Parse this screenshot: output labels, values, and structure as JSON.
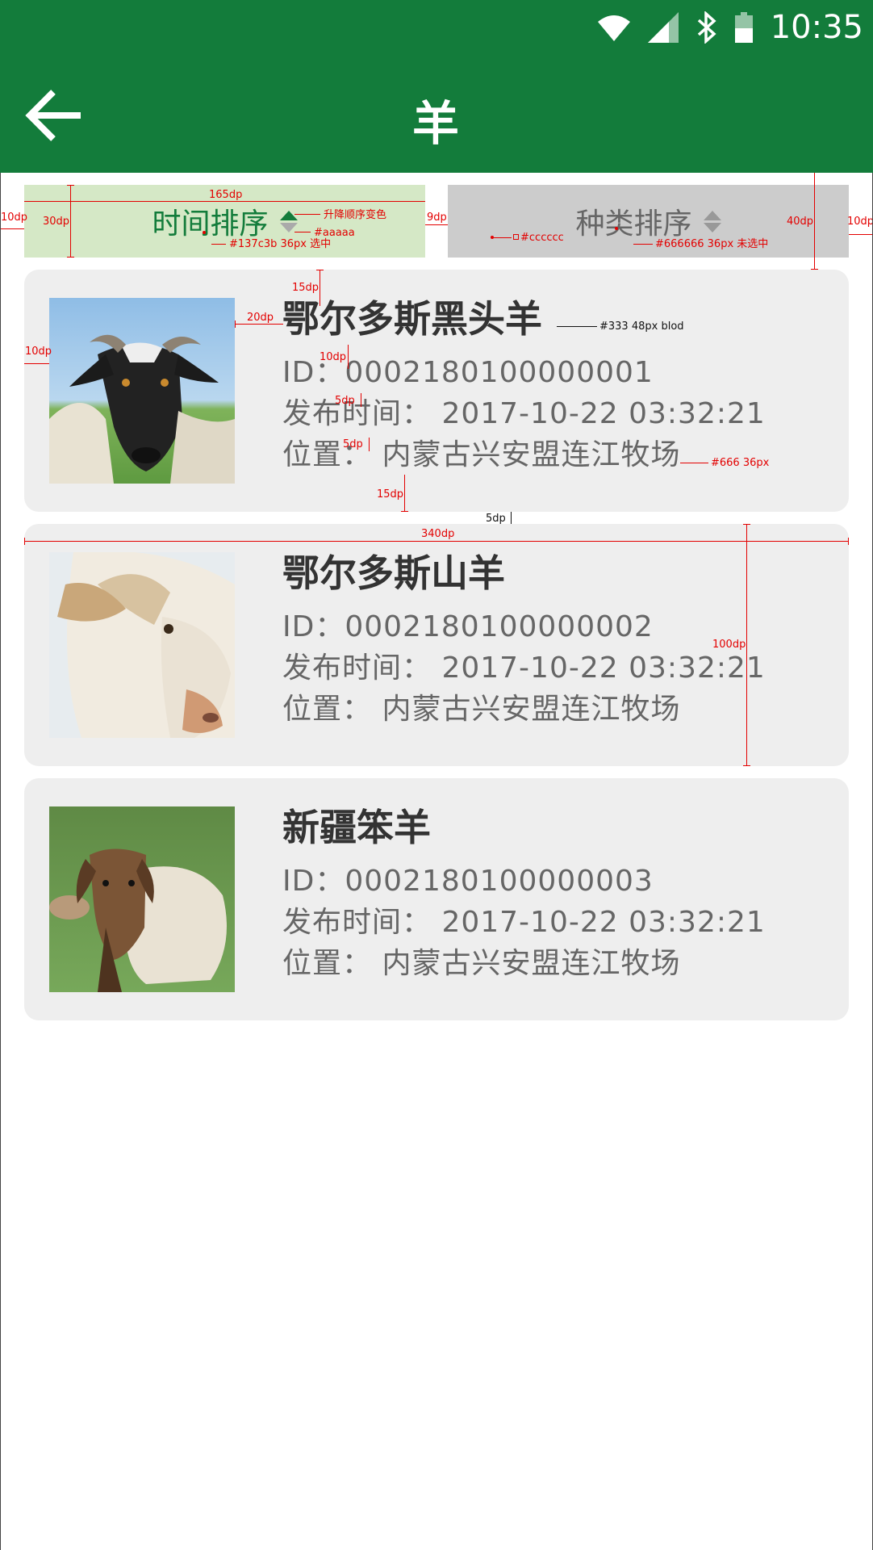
{
  "status_bar": {
    "time": "10:35",
    "icons": [
      "wifi-icon",
      "signal-icon",
      "bluetooth-icon",
      "battery-icon"
    ]
  },
  "appbar": {
    "title": "羊",
    "back_icon": "arrow-left-icon",
    "color": "#137c3b"
  },
  "sort": {
    "time_label": "时间排序",
    "type_label": "种类排序",
    "selected_color": "#137c3b",
    "unselected_color": "#666666",
    "selected_bg": "#d5e8c6",
    "unselected_bg": "#cccccc"
  },
  "items": [
    {
      "name": "鄂尔多斯黑头羊",
      "id": "ID：0002180100000001",
      "time": "发布时间：  2017-10-22  03:32:21",
      "location": "位置：  内蒙古兴安盟连江牧场"
    },
    {
      "name": "鄂尔多斯山羊",
      "id": "ID：0002180100000002",
      "time": "发布时间：  2017-10-22  03:32:21",
      "location": "位置：  内蒙古兴安盟连江牧场"
    },
    {
      "name": "新疆笨羊",
      "id": "ID：0002180100000003",
      "time": "发布时间：  2017-10-22  03:32:21",
      "location": "位置：  内蒙古兴安盟连江牧场"
    }
  ],
  "annotations": {
    "w165": "165dp",
    "h30": "30dp",
    "left10": "10dp",
    "gap9": "9dp",
    "h40": "40dp",
    "right10": "10dp",
    "asc_note": "升降顺序变色",
    "gray_note": "#aaaaa",
    "sel_note": "#137c3b 36px 选中",
    "bg_note": "#cccccc",
    "unsel_note": "#666666 36px 未选中",
    "top15": "15dp",
    "pad20": "20dp",
    "title_note": "#333 48px blod",
    "pad10": "10dp",
    "gap10": "10dp",
    "gap5a": "5dp",
    "gap5b": "5dp",
    "text_note": "#666 36px",
    "bottom15": "15dp",
    "card_gap": "5dp",
    "w340": "340dp",
    "h100": "100dp"
  }
}
